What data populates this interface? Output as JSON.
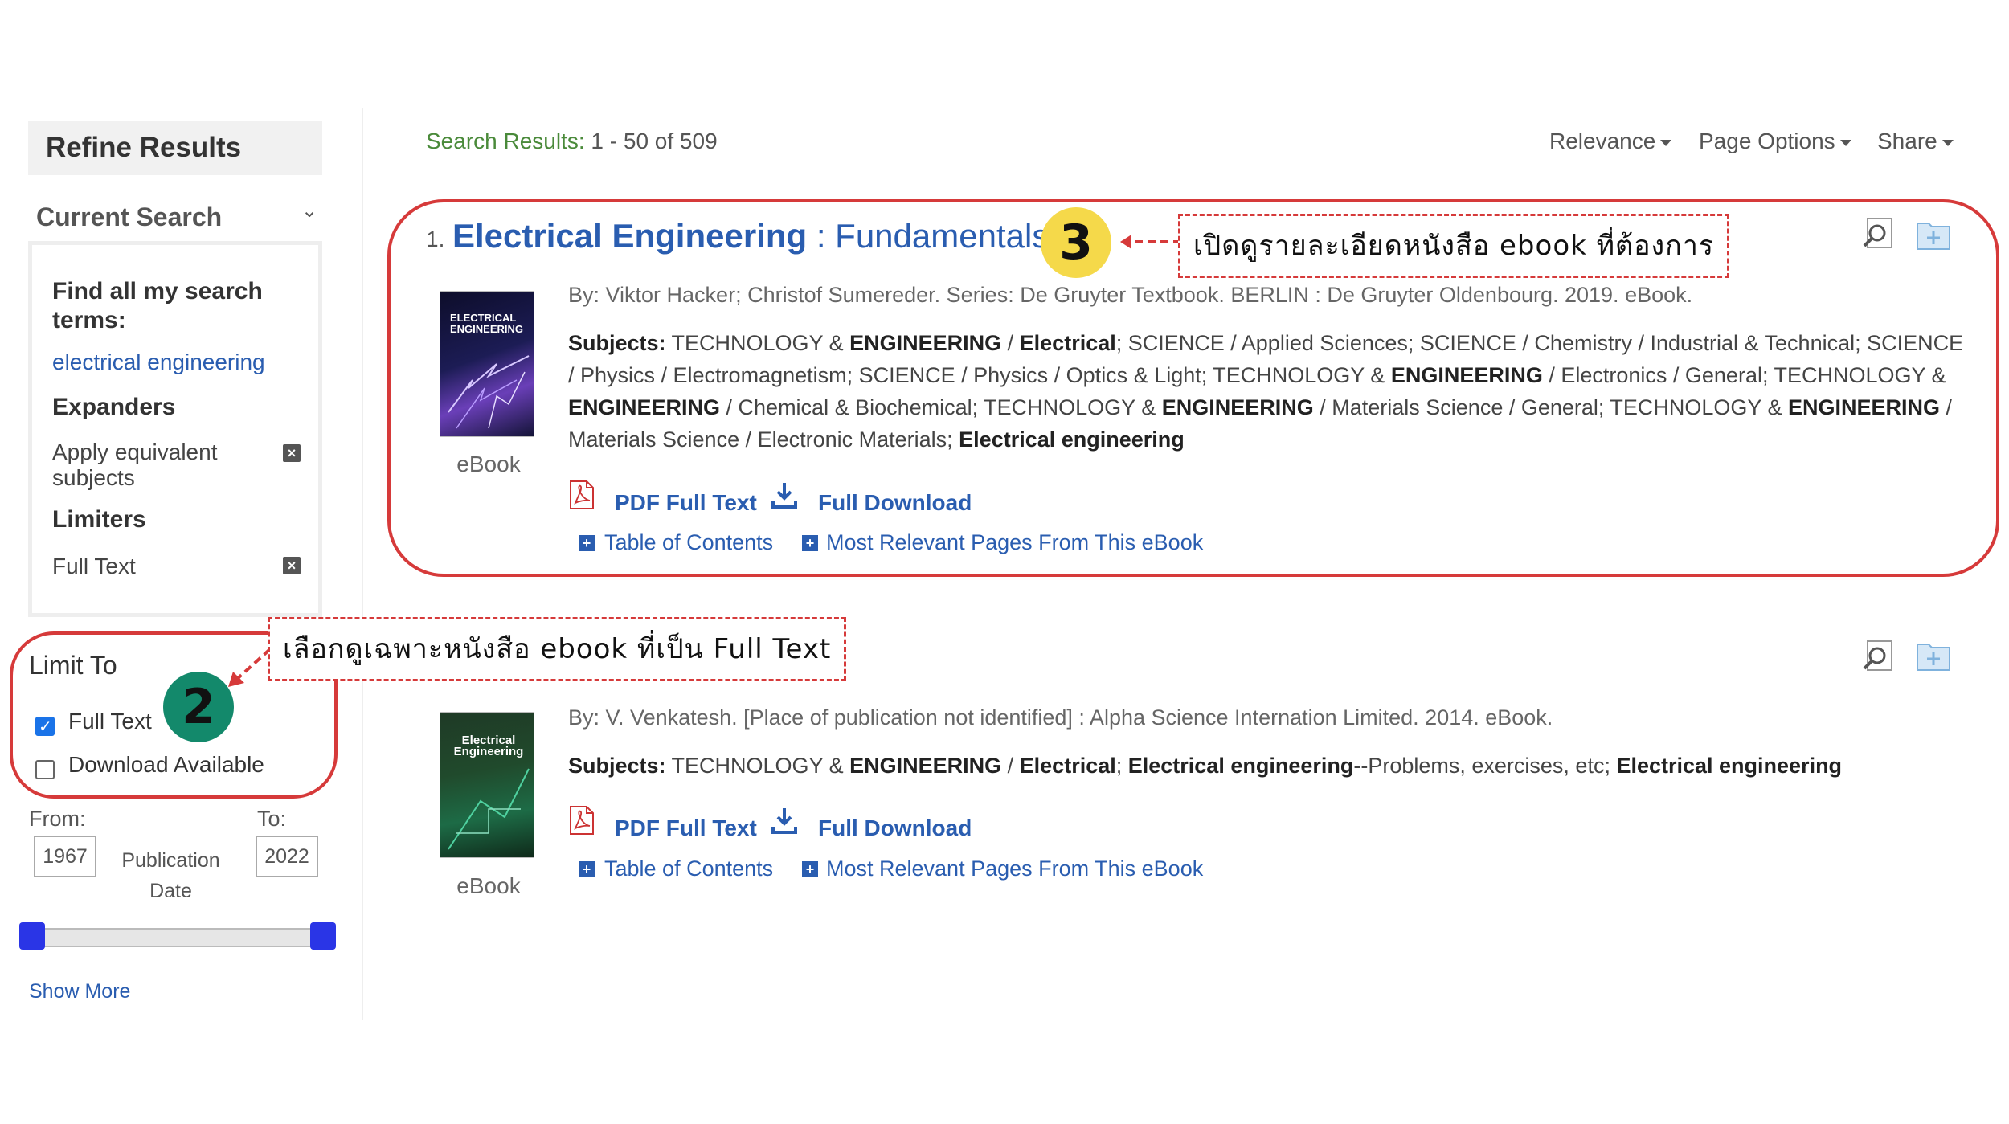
{
  "sidebar": {
    "refine_title": "Refine Results",
    "current_search": "Current Search",
    "find_all_label": "Find all my search terms:",
    "search_term": "electrical engineering",
    "expanders_label": "Expanders",
    "expander_item": "Apply equivalent subjects",
    "limiters_label": "Limiters",
    "limiter_item": "Full Text",
    "limit_to_label": "Limit To",
    "limit_options": [
      {
        "label": "Full Text",
        "checked": true
      },
      {
        "label": "Download Available",
        "checked": false
      }
    ],
    "from_label": "From:",
    "to_label": "To:",
    "from_value": "1967",
    "to_value": "2022",
    "pub_date_label": "Publication Date",
    "show_more": "Show More"
  },
  "results_header": {
    "label": "Search Results:",
    "range": "1 - 50 of 509",
    "sort": "Relevance",
    "page_options": "Page Options",
    "share": "Share"
  },
  "results": [
    {
      "number": "1.",
      "title_main": "Electrical Engineering",
      "title_sub": ": Fundamentals",
      "byline": "By: Viktor Hacker; Christof Sumereder. Series: De Gruyter Textbook. BERLIN : De Gruyter Oldenbourg. 2019. eBook.",
      "subjects_label": "Subjects:",
      "type": "eBook",
      "cover_title": "ELECTRICAL ENGINEERING",
      "pdf_label": "PDF Full Text",
      "download_label": "Full Download",
      "toc_label": "Table of Contents",
      "relevant_label": "Most Relevant Pages From This eBook"
    },
    {
      "byline": "By: V. Venkatesh. [Place of publication not identified] : Alpha Science Internation Limited. 2014. eBook.",
      "subjects_label": "Subjects:",
      "type": "eBook",
      "cover_title": "Electrical Engineering",
      "pdf_label": "PDF Full Text",
      "download_label": "Full Download",
      "toc_label": "Table of Contents",
      "relevant_label": "Most Relevant Pages From This eBook"
    }
  ],
  "annotations": {
    "step2_number": "2",
    "step2_text": "เลือกดูเฉพาะหนังสือ ebook ที่เป็น Full Text",
    "step3_number": "3",
    "step3_text": "เปิดดูรายละเอียดหนังสือ ebook ที่ต้องการ"
  },
  "colors": {
    "link_blue": "#2a5db0",
    "annotation_red": "#d63a3a",
    "badge_green": "#13896b",
    "badge_yellow": "#f5d94a",
    "results_green": "#4a8a3a",
    "slider_handle": "#2a35e6"
  },
  "icons": [
    "pdf-icon",
    "download-icon",
    "plus-icon",
    "zoom-icon",
    "add-folder-icon",
    "close-icon",
    "chevron-down-icon"
  ]
}
